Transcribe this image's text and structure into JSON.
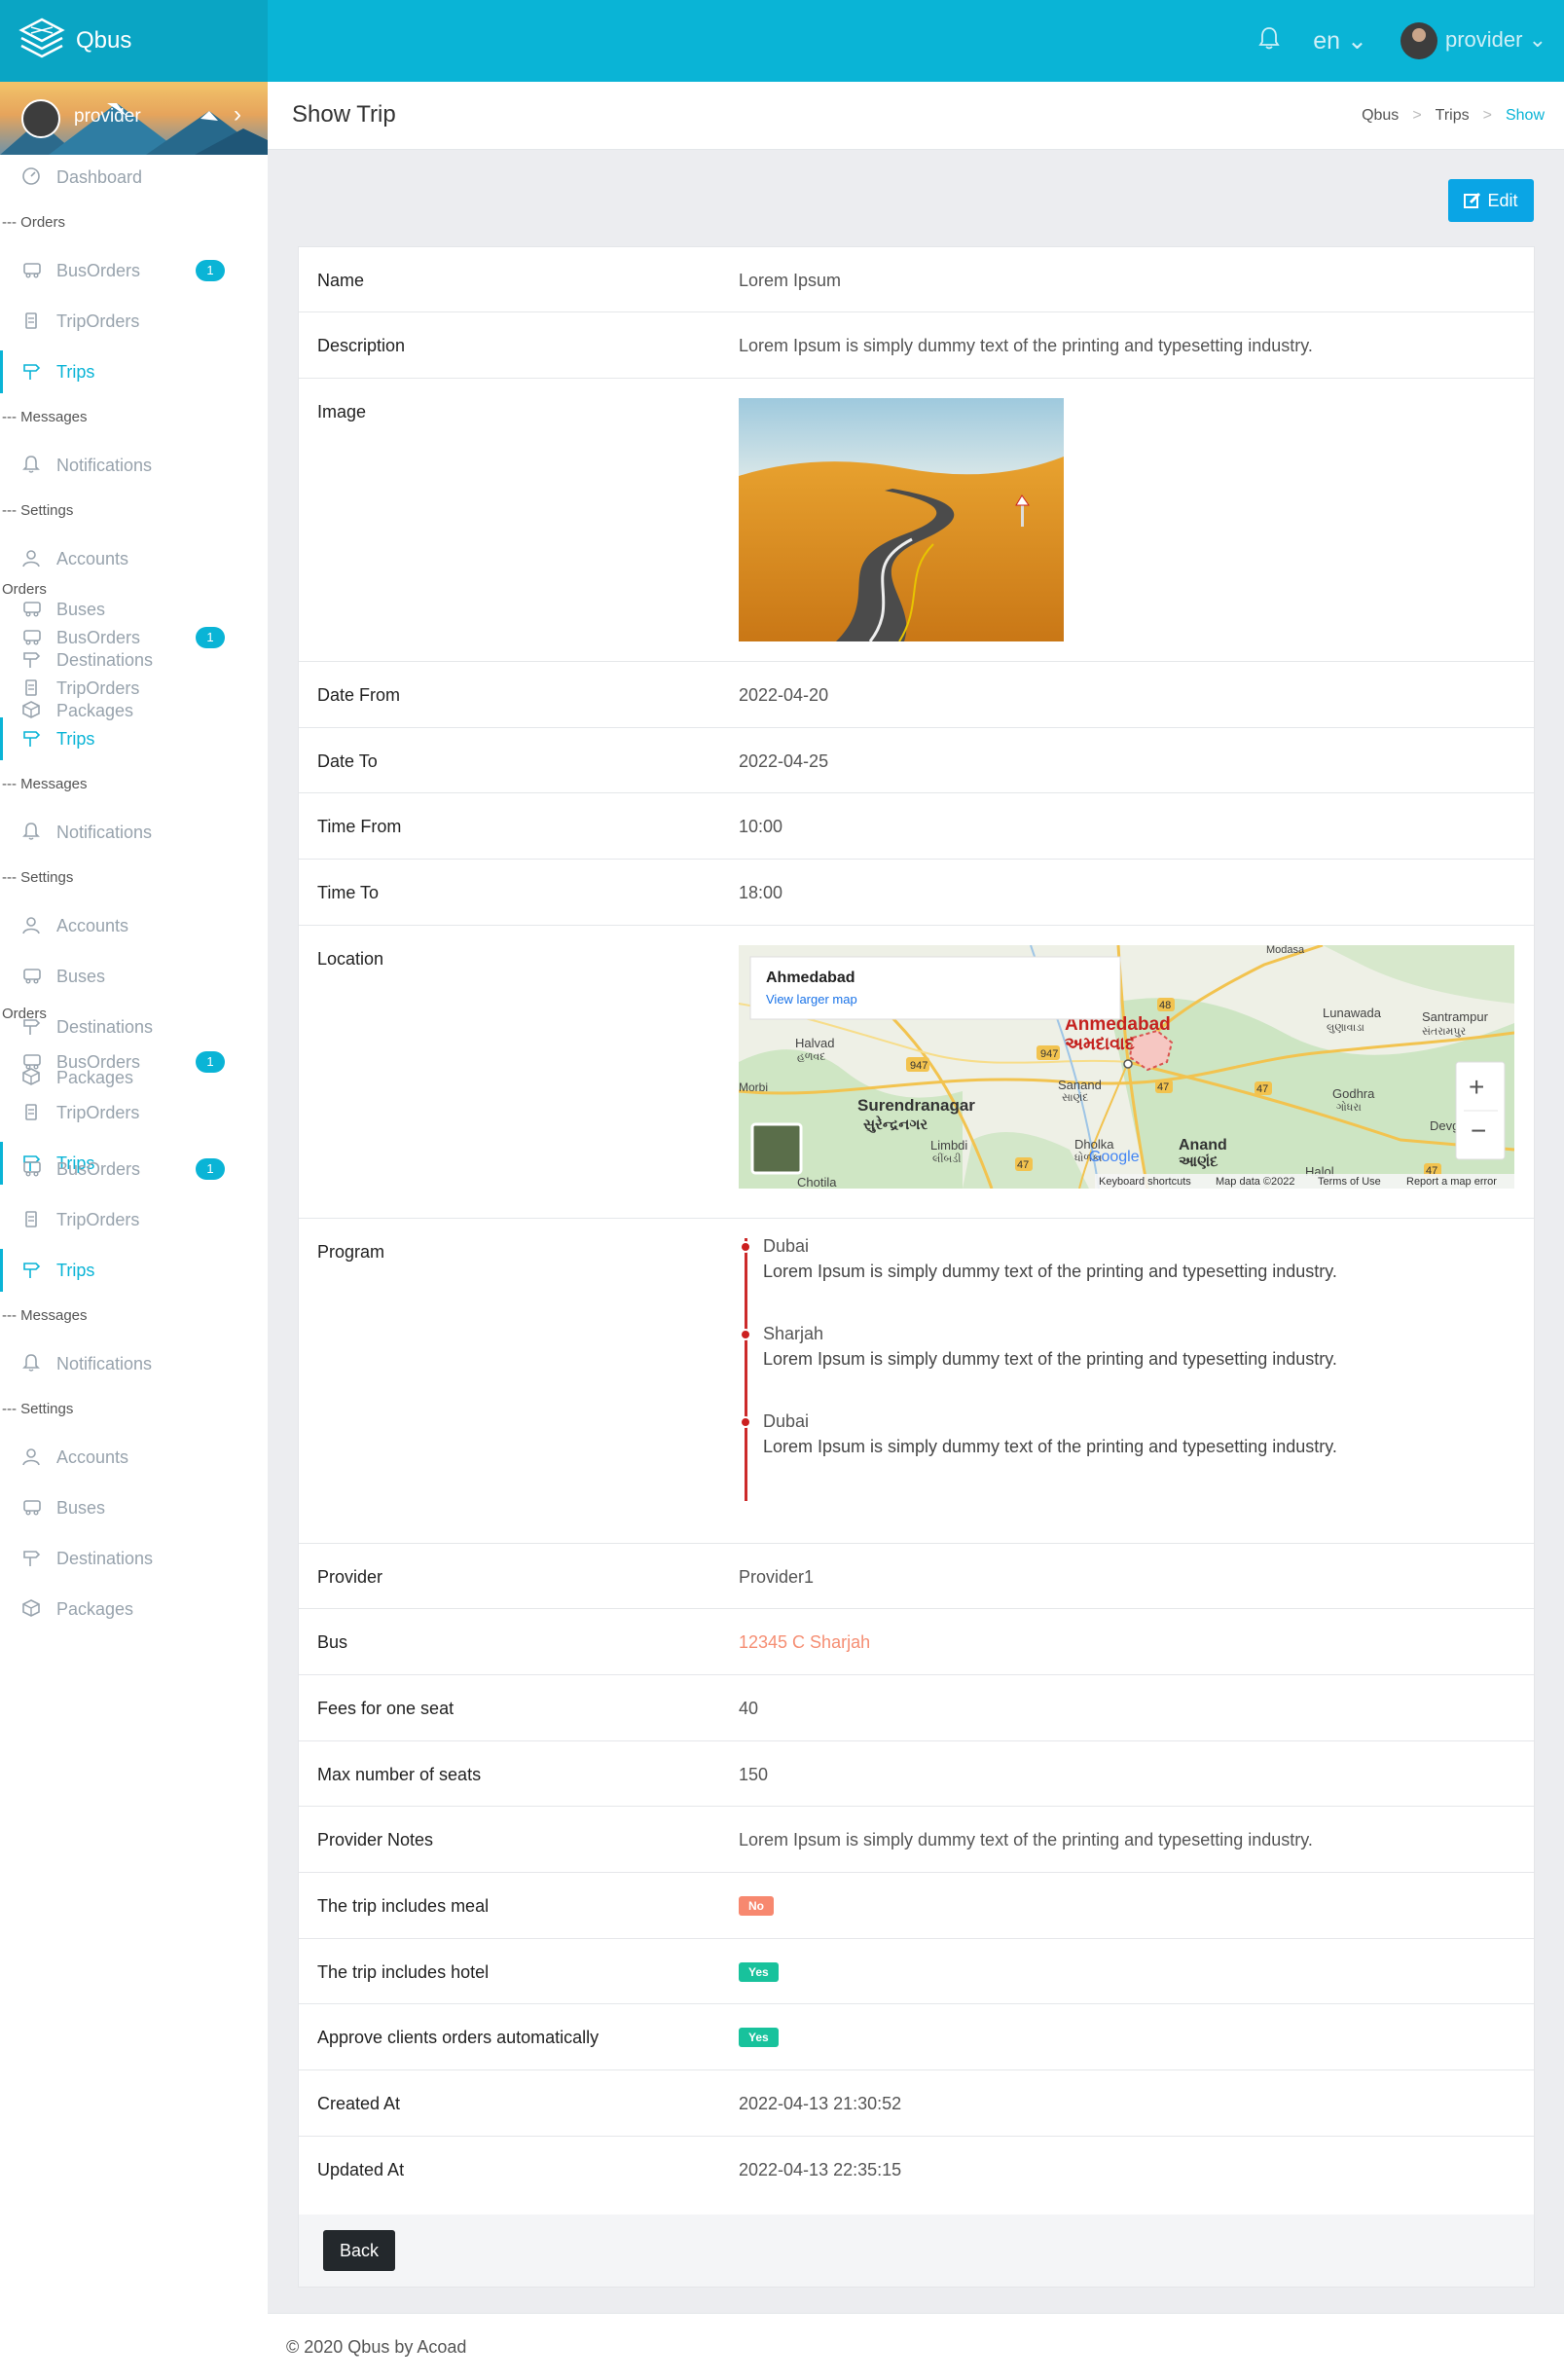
{
  "app": {
    "name": "Qbus",
    "language": "en",
    "user": "provider"
  },
  "sidebar": {
    "profile_name": "provider",
    "groups": [
      {
        "items": [
          {
            "label": "Dashboard",
            "icon": "gauge-icon",
            "badge": "",
            "active": false
          },
          {
            "header": "--- Orders"
          },
          {
            "label": "BusOrders",
            "icon": "bus-icon",
            "badge": "1",
            "active": false
          },
          {
            "label": "TripOrders",
            "icon": "clipboard-icon",
            "badge": "",
            "active": false
          },
          {
            "label": "Trips",
            "icon": "signpost-icon",
            "badge": "",
            "active": true
          },
          {
            "header": "--- Messages"
          },
          {
            "label": "Notifications",
            "icon": "bell-icon",
            "badge": "",
            "active": false
          },
          {
            "header": "--- Settings"
          },
          {
            "label": "Accounts",
            "icon": "user-icon",
            "badge": "",
            "active": false
          },
          {
            "label": "Buses",
            "icon": "bus-icon",
            "badge": "",
            "active": false
          },
          {
            "label": "Destinations",
            "icon": "signpost-icon",
            "badge": "",
            "active": false
          },
          {
            "label": "Packages",
            "icon": "box-icon",
            "badge": "",
            "active": false
          }
        ]
      },
      {
        "items": [
          {
            "header": "Orders"
          },
          {
            "label": "BusOrders",
            "icon": "bus-icon",
            "badge": "1",
            "active": false
          },
          {
            "label": "TripOrders",
            "icon": "clipboard-icon",
            "badge": "",
            "active": false
          },
          {
            "label": "Trips",
            "icon": "signpost-icon",
            "badge": "",
            "active": true
          },
          {
            "header": "--- Messages"
          },
          {
            "label": "Notifications",
            "icon": "bell-icon",
            "badge": "",
            "active": false
          },
          {
            "header": "--- Settings"
          },
          {
            "label": "Accounts",
            "icon": "user-icon",
            "badge": "",
            "active": false
          },
          {
            "label": "Buses",
            "icon": "bus-icon",
            "badge": "",
            "active": false
          },
          {
            "label": "Destinations",
            "icon": "signpost-icon",
            "badge": "",
            "active": false
          },
          {
            "label": "Packages",
            "icon": "box-icon",
            "badge": "",
            "active": false
          }
        ]
      },
      {
        "items": [
          {
            "header": "Orders"
          },
          {
            "label": "BusOrders",
            "icon": "bus-icon",
            "badge": "1",
            "active": false
          },
          {
            "label": "TripOrders",
            "icon": "clipboard-icon",
            "badge": "",
            "active": false
          },
          {
            "label": "Trips",
            "icon": "signpost-icon",
            "badge": "",
            "active": true
          }
        ]
      },
      {
        "items": [
          {
            "label": "BusOrders",
            "icon": "bus-icon",
            "badge": "1",
            "active": false
          },
          {
            "label": "TripOrders",
            "icon": "clipboard-icon",
            "badge": "",
            "active": false
          },
          {
            "label": "Trips",
            "icon": "signpost-icon",
            "badge": "",
            "active": true
          },
          {
            "header": "--- Messages"
          },
          {
            "label": "Notifications",
            "icon": "bell-icon",
            "badge": "",
            "active": false
          },
          {
            "header": "--- Settings"
          },
          {
            "label": "Accounts",
            "icon": "user-icon",
            "badge": "",
            "active": false
          },
          {
            "label": "Buses",
            "icon": "bus-icon",
            "badge": "",
            "active": false
          },
          {
            "label": "Destinations",
            "icon": "signpost-icon",
            "badge": "",
            "active": false
          },
          {
            "label": "Packages",
            "icon": "box-icon",
            "badge": "",
            "active": false
          }
        ]
      }
    ]
  },
  "header": {
    "title": "Show Trip",
    "breadcrumbs": [
      "Qbus",
      "Trips",
      "Show"
    ]
  },
  "actions": {
    "edit_label": "Edit",
    "back_label": "Back"
  },
  "trip": {
    "name_label": "Name",
    "name": "Lorem Ipsum",
    "description_label": "Description",
    "description": "Lorem Ipsum is simply dummy text of the printing and typesetting industry.",
    "image_label": "Image",
    "date_from_label": "Date From",
    "date_from": "2022-04-20",
    "date_to_label": "Date To",
    "date_to": "2022-04-25",
    "time_from_label": "Time From",
    "time_from": "10:00",
    "time_to_label": "Time To",
    "time_to": "18:00",
    "location_label": "Location",
    "program_label": "Program",
    "program": [
      {
        "city": "Dubai",
        "text": "Lorem Ipsum is simply dummy text of the printing and typesetting industry."
      },
      {
        "city": "Sharjah",
        "text": "Lorem Ipsum is simply dummy text of the printing and typesetting industry."
      },
      {
        "city": "Dubai",
        "text": "Lorem Ipsum is simply dummy text of the printing and typesetting industry."
      }
    ],
    "provider_label": "Provider",
    "provider": "Provider1",
    "bus_label": "Bus",
    "bus": "12345 C Sharjah",
    "fees_label": "Fees for one seat",
    "fees": "40",
    "max_seats_label": "Max number of seats",
    "max_seats": "150",
    "provider_notes_label": "Provider Notes",
    "provider_notes": "Lorem Ipsum is simply dummy text of the printing and typesetting industry.",
    "meal_label": "The trip includes meal",
    "meal": "No",
    "hotel_label": "The trip includes hotel",
    "hotel": "Yes",
    "auto_approve_label": "Approve clients orders automatically",
    "auto_approve": "Yes",
    "created_at_label": "Created At",
    "created_at": "2022-04-13 21:30:52",
    "updated_at_label": "Updated At",
    "updated_at": "2022-04-13 22:35:15"
  },
  "map": {
    "place_title": "Ahmedabad",
    "larger_map_link": "View larger map",
    "labels": [
      "Ahmedabad",
      "અમદાવાદ",
      "Surendranagar",
      "સુરેન્દ્રનગર",
      "Halvad",
      "હળવદ",
      "Lunawada",
      "લુણાવાડા",
      "Santrampur",
      "સંતરામપુર",
      "Godhra",
      "ગોધરા",
      "Anand",
      "આણંદ",
      "Dholka",
      "ધોળકા",
      "Limbdi",
      "લીંબડી",
      "Sanand",
      "સાણંદ",
      "Chotila",
      "Halol",
      "Modasa",
      "Devg",
      "Morbi"
    ],
    "highways": [
      "947",
      "48",
      "947",
      "47",
      "47",
      "47",
      "47"
    ],
    "footer": [
      "Keyboard shortcuts",
      "Map data ©2022",
      "Terms of Use",
      "Report a map error"
    ],
    "brand": "Google"
  },
  "footer": {
    "text": "© 2020 Qbus by Acoad"
  },
  "colors": {
    "primary": "#0ab4d6",
    "edit": "#0aa5e5",
    "link": "#f58e73",
    "no_badge": "#f7886f",
    "yes_badge": "#18c29c",
    "timeline": "#cc2a2a"
  }
}
